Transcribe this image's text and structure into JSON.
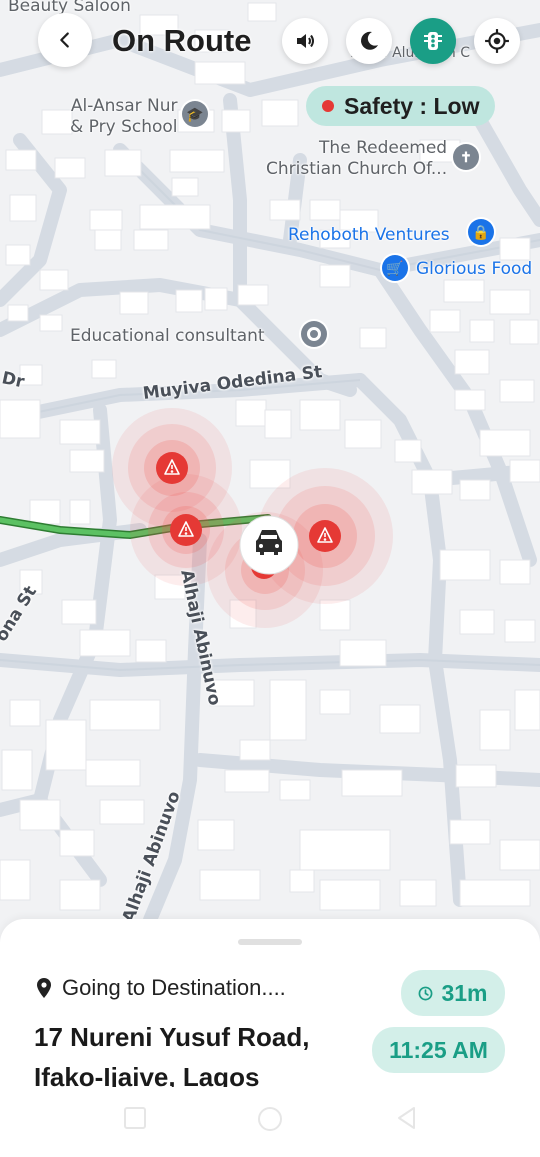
{
  "header": {
    "title": "On Route",
    "back_icon": "chevron-left-icon",
    "sound_icon": "speaker-icon",
    "night_icon": "moon-icon",
    "traffic_icon": "traffic-light-icon",
    "locate_icon": "crosshair-icon"
  },
  "safety": {
    "label": "Safety : Low",
    "status_color": "#e53935"
  },
  "map": {
    "pois": [
      {
        "label": "Beauty Saloon",
        "type": "text"
      },
      {
        "label": "Al-Ansar Nur\n& Pry School",
        "icon": "school-icon"
      },
      {
        "label": "The Redeemed\nChristian Church Of...",
        "icon": "church-icon"
      },
      {
        "label": "Rehoboth Ventures",
        "icon": "shopping-bag-icon"
      },
      {
        "label": "Glorious Food",
        "icon": "shopping-cart-icon"
      },
      {
        "label": "Educational consultant",
        "icon": "place-icon"
      },
      {
        "label": "Lek... Alum...th C",
        "icon": ""
      }
    ],
    "streets": [
      "Muyiva Odedina St",
      "Alhaji Abinuvo",
      "Alhaji Abinuvo",
      "Dr",
      "ona St"
    ],
    "hazard_icon": "warning-icon",
    "vehicle_icon": "car-icon",
    "route_color": "#4caf50",
    "hazard_color": "#e53935"
  },
  "trip": {
    "status": "Going to Destination....",
    "address_line1": "17 Nureni Yusuf Road,",
    "address_line2": "Ifako-Ijaive, Lagos",
    "duration": "31m",
    "eta": "11:25 AM",
    "accent": "#1a9e86"
  },
  "system_nav": {
    "recent_icon": "square-icon",
    "home_icon": "circle-icon",
    "back_icon": "triangle-back-icon"
  }
}
